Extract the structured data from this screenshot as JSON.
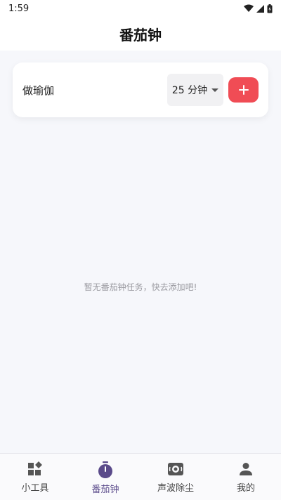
{
  "status_bar": {
    "time": "1:59"
  },
  "app_bar": {
    "title": "番茄钟"
  },
  "add_task": {
    "input_value": "做瑜伽",
    "duration_label": "25 分钟",
    "add_label": "+"
  },
  "empty_state": {
    "message": "暂无番茄钟任务，快去添加吧!"
  },
  "bottom_nav": {
    "active_index": 1,
    "items": [
      {
        "label": "小工具",
        "icon": "widgets-icon"
      },
      {
        "label": "番茄钟",
        "icon": "timer-icon"
      },
      {
        "label": "声波除尘",
        "icon": "speaker-icon"
      },
      {
        "label": "我的",
        "icon": "person-icon"
      }
    ]
  },
  "colors": {
    "accent": "#f04c55",
    "nav_active": "#5a4a8a",
    "background": "#f6f7fb"
  }
}
